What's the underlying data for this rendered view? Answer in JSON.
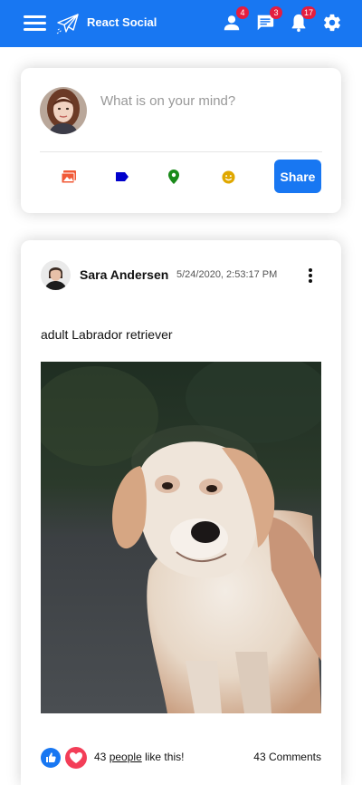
{
  "topbar": {
    "title": "React Social",
    "color": "#1877f2",
    "icons": {
      "menu": "hamburger-icon",
      "logo": "paper-plane-icon",
      "friends": "person-icon",
      "messages": "chat-icon",
      "notifications": "bell-icon",
      "settings": "gear-icon"
    },
    "badges": {
      "friends": "4",
      "messages": "3",
      "notifications": "17"
    }
  },
  "composer": {
    "placeholder": "What is on your mind?",
    "options": [
      {
        "icon": "photo-icon",
        "color": "#f15a37"
      },
      {
        "icon": "tag-icon",
        "color": "#0000cc"
      },
      {
        "icon": "location-pin-icon",
        "color": "#1a8a1a"
      },
      {
        "icon": "emoji-icon",
        "color": "#e0a800"
      }
    ],
    "share_label": "Share"
  },
  "post": {
    "author": "Sara Andersen",
    "date": "5/24/2020, 2:53:17 PM",
    "text": "adult Labrador retriever",
    "image": "dog-photo",
    "likes_count": "43",
    "likes_link": "people",
    "likes_suffix": "like this!",
    "comments": "43 Comments"
  }
}
